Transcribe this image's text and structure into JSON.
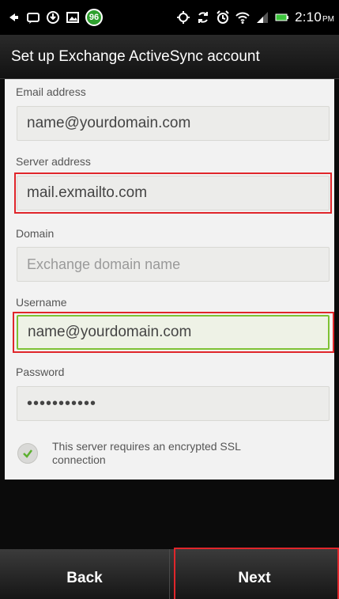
{
  "status_bar": {
    "badge_count": "96",
    "time": "2:10",
    "time_suffix": "PM",
    "icons": [
      "back-arrow-icon",
      "message-icon",
      "download-icon",
      "image-icon",
      "gps-icon",
      "sync-icon",
      "alarm-icon",
      "wifi-icon",
      "signal-icon",
      "battery-icon"
    ]
  },
  "header": {
    "title": "Set up Exchange ActiveSync account"
  },
  "form": {
    "email": {
      "label": "Email address",
      "value": "name@yourdomain.com"
    },
    "server": {
      "label": "Server address",
      "value": "mail.exmailto.com"
    },
    "domain": {
      "label": "Domain",
      "placeholder": "Exchange domain name"
    },
    "username": {
      "label": "Username",
      "value": "name@yourdomain.com"
    },
    "password": {
      "label": "Password",
      "value": "•••••••••••"
    },
    "ssl": {
      "label": "This server requires an encrypted SSL connection",
      "checked": true
    }
  },
  "footer": {
    "back_label": "Back",
    "next_label": "Next"
  },
  "colors": {
    "highlight": "#e0262b",
    "focus": "#7ec234",
    "check": "#5cb030"
  }
}
